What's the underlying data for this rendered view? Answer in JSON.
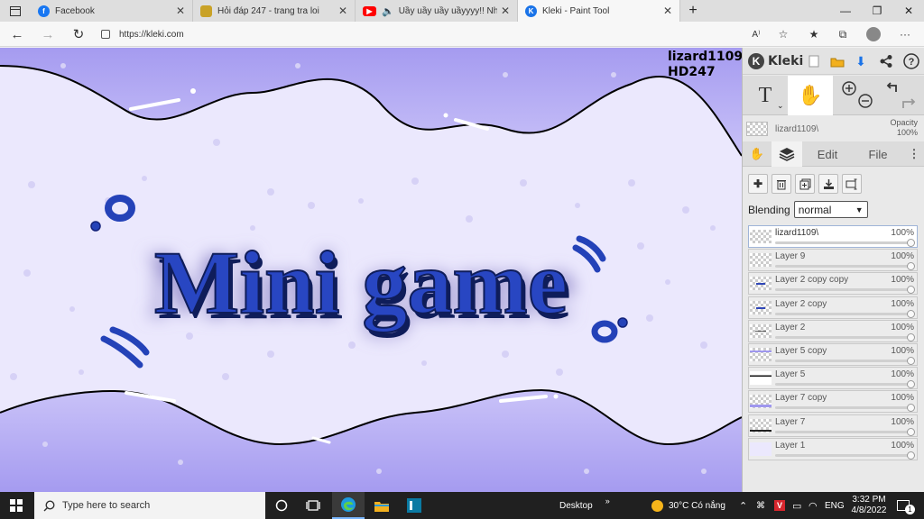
{
  "browser": {
    "tabs": [
      {
        "title": "Facebook",
        "icon": "facebook-icon",
        "color": "#1877f2"
      },
      {
        "title": "Hỏi đáp 247 - trang tra loi",
        "icon": "page-icon",
        "color": "#c9a227"
      },
      {
        "title": "Uầy uầy uầy uầyyyy!! Nhữn",
        "icon": "youtube-icon",
        "color": "#ff0000"
      },
      {
        "title": "Kleki - Paint Tool",
        "icon": "kleki-icon",
        "color": "#1a73e8",
        "active": true
      }
    ],
    "url": "https://kleki.com"
  },
  "canvas": {
    "credit_line1": "lizard1109",
    "credit_line2": "HD247",
    "artwork_text": "Mini game",
    "colors": {
      "background": "#ebe8fd",
      "band": "#aea4f2",
      "text": "#1f3fb0"
    }
  },
  "panel": {
    "logo": "Kleki",
    "brush_layer_name": "lizard1109\\",
    "opacity_label": "Opacity",
    "opacity_value": "100%",
    "tabs": {
      "edit": "Edit",
      "file": "File"
    },
    "blending_label": "Blending",
    "blending_value": "normal",
    "layers": [
      {
        "name": "lizard1109\\",
        "opacity": "100%",
        "selected": true
      },
      {
        "name": "Layer 9",
        "opacity": "100%"
      },
      {
        "name": "Layer 2 copy copy",
        "opacity": "100%"
      },
      {
        "name": "Layer 2 copy",
        "opacity": "100%"
      },
      {
        "name": "Layer 2",
        "opacity": "100%"
      },
      {
        "name": "Layer 5 copy",
        "opacity": "100%"
      },
      {
        "name": "Layer 5",
        "opacity": "100%"
      },
      {
        "name": "Layer 7 copy",
        "opacity": "100%"
      },
      {
        "name": "Layer 7",
        "opacity": "100%"
      },
      {
        "name": "Layer 1",
        "opacity": "100%"
      }
    ]
  },
  "taskbar": {
    "search_placeholder": "Type here to search",
    "desktop_label": "Desktop",
    "weather": "30°C  Có nắng",
    "lang": "ENG",
    "time": "3:32 PM",
    "date": "4/8/2022",
    "notif_count": "1"
  }
}
